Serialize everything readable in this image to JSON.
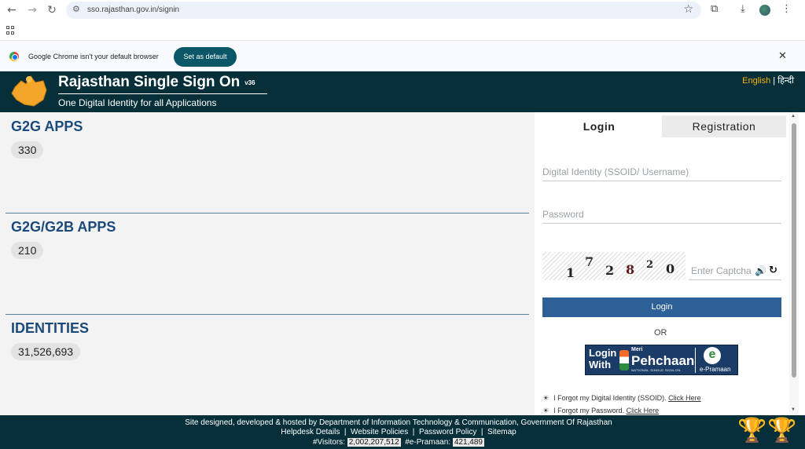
{
  "browser": {
    "url": "sso.rajasthan.gov.in/signin",
    "back_icon": "←",
    "forward_icon": "→",
    "reload_icon": "↻",
    "tune_icon": "⚙",
    "star_icon": "☆",
    "extensions_icon": "⧉",
    "download_icon": "⤓",
    "menu_icon": "⋮"
  },
  "infobar": {
    "message": "Google Chrome isn't your default browser",
    "button": "Set as default",
    "close_icon": "✕"
  },
  "header": {
    "title": "Rajasthan Single Sign On",
    "version": "v36",
    "subtitle": "One Digital Identity for all Applications",
    "lang_en": "English",
    "lang_sep": " | ",
    "lang_hi": "हिन्दी",
    "logo_text": "Rajasthan"
  },
  "stats": [
    {
      "title": "G2G APPS",
      "value": "330"
    },
    {
      "title": "G2G/G2B APPS",
      "value": "210"
    },
    {
      "title": "IDENTITIES",
      "value": "31,526,693"
    }
  ],
  "panel": {
    "tab_login": "Login",
    "tab_registration": "Registration",
    "username_placeholder": "Digital Identity (SSOID/ Username)",
    "password_placeholder": "Password",
    "captcha_digits": [
      "1",
      "7",
      "2",
      "8",
      "2",
      "0"
    ],
    "captcha_placeholder": "Enter Captcha",
    "speaker_icon": "🔊",
    "refresh_icon": "↻",
    "login_button": "Login",
    "or_text": "OR",
    "mp_login": "Login",
    "mp_with": "With",
    "mp_meri": "Meri",
    "mp_pehchaan": "Pehchaan",
    "mp_nsso": "NATIONAL SINGLE SIGN-ON",
    "mp_epramaan": "e-Pramaan",
    "mp_e": "e",
    "forgot_id_text": "I Forgot my Digital Identity (SSOID).",
    "forgot_id_link": "Click Here",
    "forgot_pw_text": "I Forgot my Password.",
    "forgot_pw_link": "Click Here",
    "bullet": "☀"
  },
  "footer": {
    "line1": "Site designed, developed & hosted by Department of Information Technology & Communication, Government Of Rajasthan",
    "links": [
      "Helpdesk Details",
      "Website Policies",
      "Password Policy",
      "Sitemap"
    ],
    "visitors_label": "#Visitors:",
    "visitors_value": "2,002,207,512",
    "epramaan_label": "#e-Pramaan:",
    "epramaan_value": "421,489",
    "trophy_icon": "🏆"
  }
}
